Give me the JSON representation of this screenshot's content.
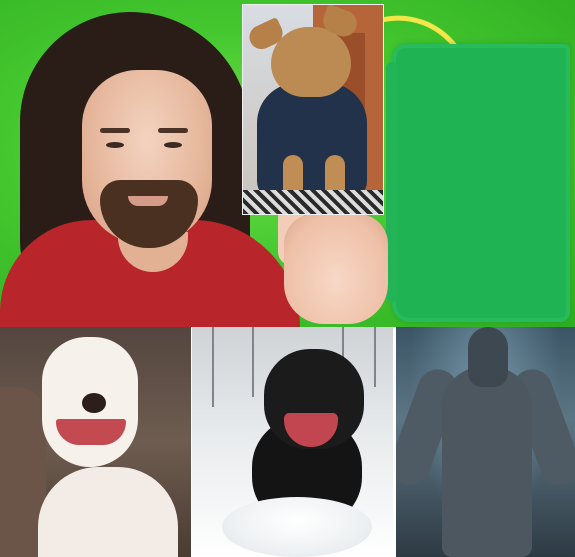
{
  "image": {
    "description_items": [
      {
        "name": "man-with-green-screen",
        "kind": "photo"
      },
      {
        "name": "chihuahua-in-jacket",
        "kind": "photo"
      },
      {
        "name": "white-pitbull-smiling",
        "kind": "photo"
      },
      {
        "name": "black-pitbull-running-in-snow",
        "kind": "photo"
      },
      {
        "name": "werewolf-illustration",
        "kind": "illustration"
      }
    ]
  },
  "colors": {
    "green_screen": "#45c82f",
    "green_brush": "#1fb354",
    "shirt_red": "#b8252b",
    "arc_yellow": "#f3e64a"
  }
}
